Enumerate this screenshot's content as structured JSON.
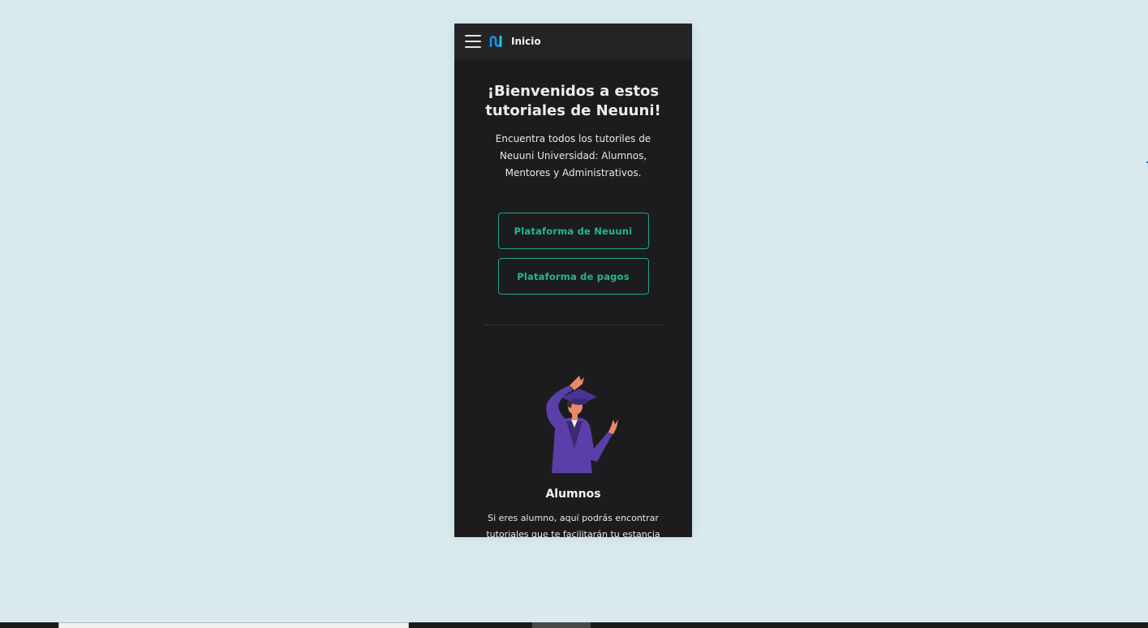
{
  "topbar": {
    "title": "Inicio",
    "menu_icon": "hamburger-menu-icon",
    "logo_icon": "neuuni-logo",
    "logo_colors": [
      "#2196f3",
      "#26c6da"
    ]
  },
  "hero": {
    "heading": "¡Bienvenidos a estos tutoriales de Neuuni!",
    "description": "Encuentra todos los tutoriles de Neuuni Universidad: Alumnos, Mentores y Administrativos."
  },
  "buttons": {
    "platform": "Plataforma de Neuuni",
    "payments": "Plataforma de pagos"
  },
  "students": {
    "illustration": "graduate-student-illustration",
    "title": "Alumnos",
    "text": "Si eres alumno, aquí podrás encontrar tutoriales que te facilitarán tu estancia en"
  },
  "colors": {
    "background": "#d8eaed",
    "panel": "#1c1c1e",
    "topbar": "#242426",
    "accent": "#1ea883",
    "gown": "#5b3fa8"
  }
}
